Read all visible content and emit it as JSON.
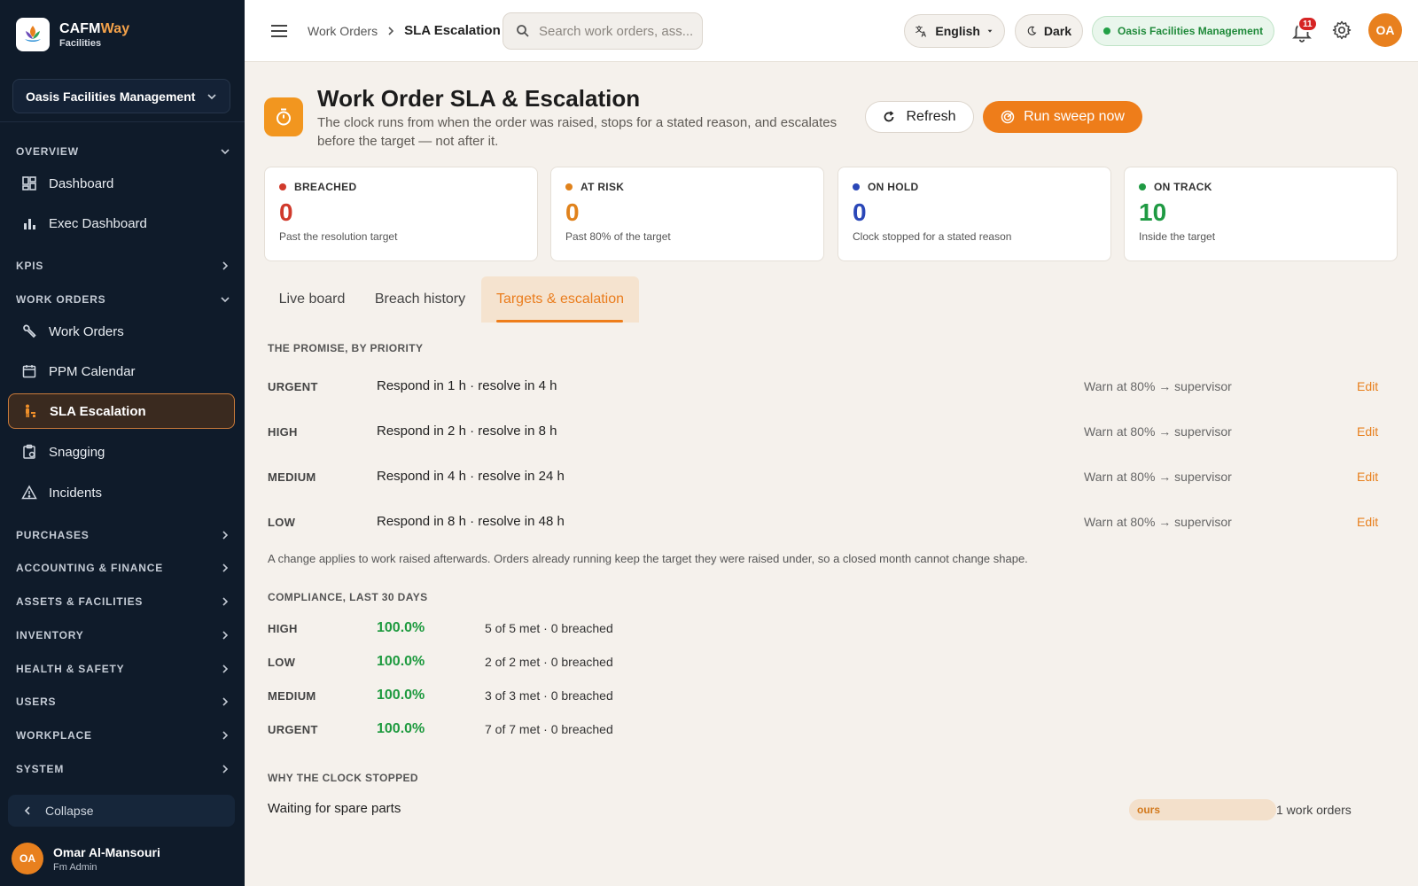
{
  "brand": {
    "name_part1": "CAFM",
    "name_part2": "Way",
    "sub": "Facilities"
  },
  "sidebar": {
    "org": "Oasis Facilities Management",
    "sections": {
      "overview": "OVERVIEW",
      "kpis": "KPIS",
      "work_orders": "WORK ORDERS",
      "purchases": "PURCHASES",
      "accounting": "ACCOUNTING & FINANCE",
      "assets": "ASSETS & FACILITIES",
      "inventory": "INVENTORY",
      "health": "HEALTH & SAFETY",
      "users": "USERS",
      "workplace": "WORKPLACE",
      "system": "SYSTEM"
    },
    "items": {
      "dashboard": "Dashboard",
      "exec_dashboard": "Exec Dashboard",
      "work_orders": "Work Orders",
      "ppm_calendar": "PPM Calendar",
      "sla_escalation": "SLA Escalation",
      "snagging": "Snagging",
      "incidents": "Incidents"
    },
    "collapse": "Collapse",
    "user": {
      "initials": "OA",
      "name": "Omar Al-Mansouri",
      "role": "Fm Admin"
    }
  },
  "header": {
    "breadcrumb": [
      "Work Orders",
      "SLA Escalation"
    ],
    "search_placeholder": "Search work orders, ass...",
    "language": "English",
    "theme": "Dark",
    "org": "Oasis Facilities Management",
    "notifications": "11",
    "avatar": "OA"
  },
  "page": {
    "title": "Work Order SLA & Escalation",
    "subtitle": "The clock runs from when the order was raised, stops for a stated reason, and escalates before the target — not after it.",
    "refresh_label": "Refresh",
    "sweep_label": "Run sweep now"
  },
  "stats": [
    {
      "label": "BREACHED",
      "value": "0",
      "desc": "Past the resolution target",
      "color": "#d03a2c"
    },
    {
      "label": "AT RISK",
      "value": "0",
      "desc": "Past 80% of the target",
      "color": "#e0821c"
    },
    {
      "label": "ON HOLD",
      "value": "0",
      "desc": "Clock stopped for a stated reason",
      "color": "#2a47b8"
    },
    {
      "label": "ON TRACK",
      "value": "10",
      "desc": "Inside the target",
      "color": "#1f9a43"
    }
  ],
  "tabs": [
    "Live board",
    "Breach history",
    "Targets & escalation"
  ],
  "promise": {
    "heading": "THE PROMISE, BY PRIORITY",
    "rows": [
      {
        "priority": "URGENT",
        "promise": "Respond in 1 h · resolve in 4 h",
        "warn": "Warn at 80% → supervisor",
        "edit": "Edit"
      },
      {
        "priority": "HIGH",
        "promise": "Respond in 2 h · resolve in 8 h",
        "warn": "Warn at 80% → supervisor",
        "edit": "Edit"
      },
      {
        "priority": "MEDIUM",
        "promise": "Respond in 4 h · resolve in 24 h",
        "warn": "Warn at 80% → supervisor",
        "edit": "Edit"
      },
      {
        "priority": "LOW",
        "promise": "Respond in 8 h · resolve in 48 h",
        "warn": "Warn at 80% → supervisor",
        "edit": "Edit"
      }
    ],
    "note": "A change applies to work raised afterwards. Orders already running keep the target they were raised under, so a closed month cannot change shape."
  },
  "compliance": {
    "heading": "COMPLIANCE, LAST 30 DAYS",
    "rows": [
      {
        "priority": "HIGH",
        "pct": "100.0%",
        "detail": "5 of 5 met · 0 breached"
      },
      {
        "priority": "LOW",
        "pct": "100.0%",
        "detail": "2 of 2 met · 0 breached"
      },
      {
        "priority": "MEDIUM",
        "pct": "100.0%",
        "detail": "3 of 3 met · 0 breached"
      },
      {
        "priority": "URGENT",
        "pct": "100.0%",
        "detail": "7 of 7 met · 0 breached"
      }
    ]
  },
  "clock_stopped": {
    "heading": "WHY THE CLOCK STOPPED",
    "rows": [
      {
        "reason": "Waiting for spare parts",
        "bar_label": "ours",
        "share": 1.0,
        "count": "1 work orders"
      }
    ]
  },
  "colors": {
    "accent": "#ee7d1a",
    "sidebar": "#0f1b2a",
    "success": "#1e9a3f"
  }
}
